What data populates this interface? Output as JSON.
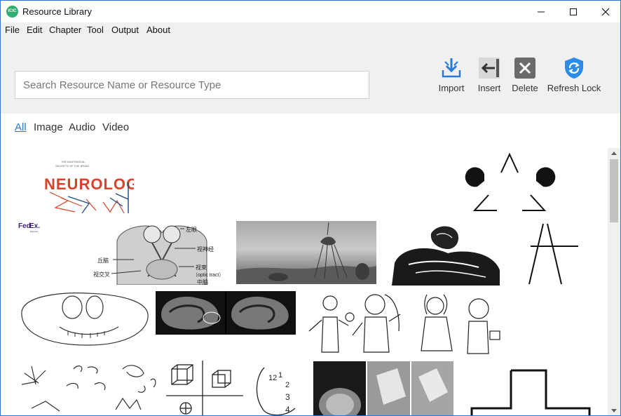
{
  "window": {
    "title": "Resource Library",
    "app_icon_text": "ICIC"
  },
  "menu": [
    "File",
    "Edit",
    "Chapter",
    "Tool",
    "Output",
    "About"
  ],
  "search": {
    "placeholder": "Search Resource Name or Resource Type",
    "value": ""
  },
  "toolbar": {
    "import_label": "Import",
    "insert_label": "Insert",
    "delete_label": "Delete",
    "refresh_label": "Refresh Lock"
  },
  "filters": {
    "all": "All",
    "image": "Image",
    "audio": "Audio",
    "video": "Video",
    "active": "All"
  },
  "thumbnails": {
    "neurologic_text": "NEUROLOGIC",
    "neurologic_small_1": "THE ANATOMICAL",
    "neurologic_small_2": "SECRETS OF THE BRAIN",
    "fedex_fed": "Fed",
    "fedex_ex": "Ex.",
    "fedex_sub": "Express",
    "anatomy_labels": [
      "左眼",
      "视神经",
      "丘脑",
      "视交叉",
      "视束",
      "（optic tract）",
      "中脑"
    ],
    "clock_numbers": [
      "12",
      "1",
      "2",
      "3",
      "4"
    ]
  },
  "colors": {
    "accent": "#2b79d6",
    "toolbar_bg": "#f0f0f0",
    "import_icon": "#2b79d6",
    "delete_icon": "#6b6b6b",
    "refresh_icon": "#2b8be6"
  }
}
